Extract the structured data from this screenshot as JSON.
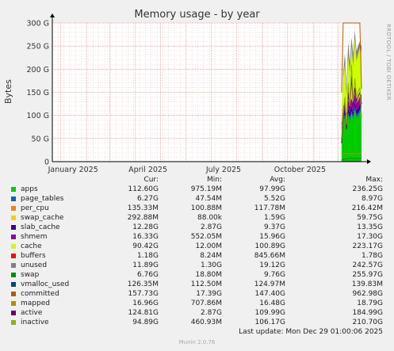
{
  "title": "Memory usage - by year",
  "watermark": "RRDTOOL / TOBI OETIKER",
  "chart_data": {
    "type": "area",
    "title": "Memory usage - by year",
    "ylabel": "Bytes",
    "ylim": [
      0,
      300
    ],
    "y_unit": "G",
    "yticks": [
      "0",
      "50 G",
      "100 G",
      "150 G",
      "200 G",
      "250 G",
      "300 G"
    ],
    "xticks": [
      "January 2025",
      "April 2025",
      "July 2025",
      "October 2025"
    ],
    "grid": true,
    "data_window": [
      "2024-12-22",
      "2025-12-29"
    ],
    "x": [
      "2025-12-05",
      "2025-12-07",
      "2025-12-09",
      "2025-12-11",
      "2025-12-13",
      "2025-12-15",
      "2025-12-17",
      "2025-12-19",
      "2025-12-21",
      "2025-12-23",
      "2025-12-25",
      "2025-12-27",
      "2025-12-29"
    ],
    "series": [
      {
        "name": "apps",
        "color": "#00cc00",
        "values": [
          60,
          92,
          95,
          75,
          100,
          88,
          103,
          90,
          112,
          95,
          98,
          105,
          112
        ]
      },
      {
        "name": "page_tables",
        "color": "#0066b3",
        "values": [
          3,
          4,
          5,
          4,
          5,
          6,
          5,
          6,
          6,
          5,
          6,
          6,
          6
        ]
      },
      {
        "name": "per_cpu",
        "color": "#ff8000",
        "values": [
          0.1,
          0.1,
          0.1,
          0.1,
          0.1,
          0.1,
          0.1,
          0.1,
          0.1,
          0.1,
          0.1,
          0.1,
          0.1
        ]
      },
      {
        "name": "swap_cache",
        "color": "#ffcc00",
        "values": [
          0.3,
          0.3,
          0.3,
          0.3,
          0.3,
          0.3,
          0.3,
          0.3,
          0.3,
          0.3,
          0.3,
          0.3,
          0.3
        ]
      },
      {
        "name": "slab_cache",
        "color": "#330099",
        "values": [
          8,
          10,
          12,
          9,
          11,
          12,
          13,
          10,
          12,
          11,
          12,
          13,
          12
        ]
      },
      {
        "name": "shmem",
        "color": "#990099",
        "values": [
          12,
          14,
          16,
          15,
          16,
          17,
          16,
          15,
          17,
          16,
          16,
          17,
          16
        ]
      },
      {
        "name": "cache",
        "color": "#ccff00",
        "values": [
          25,
          60,
          80,
          40,
          95,
          70,
          110,
          85,
          120,
          90,
          100,
          105,
          90
        ]
      },
      {
        "name": "buffers",
        "color": "#ff0000",
        "values": [
          0.5,
          0.8,
          1,
          0.8,
          1,
          1.2,
          1.1,
          1,
          1.3,
          1.1,
          1.2,
          1.2,
          1.2
        ]
      },
      {
        "name": "unused",
        "color": "#808080",
        "values": [
          2,
          10,
          25,
          15,
          30,
          20,
          20,
          25,
          15,
          20,
          18,
          12,
          12
        ]
      }
    ],
    "lines": [
      {
        "name": "swap",
        "color": "#008f00",
        "values": [
          3,
          5,
          6,
          6,
          7,
          6,
          7,
          6,
          7,
          7,
          6,
          7,
          7
        ]
      },
      {
        "name": "vmalloc_used",
        "color": "#00487d",
        "values": [
          0.12,
          0.12,
          0.13,
          0.12,
          0.13,
          0.12,
          0.13,
          0.12,
          0.13,
          0.13,
          0.13,
          0.13,
          0.13
        ]
      },
      {
        "name": "committed",
        "color": "#b35a00",
        "values": [
          150,
          600,
          900,
          400,
          962,
          300,
          700,
          500,
          800,
          400,
          600,
          500,
          158
        ]
      },
      {
        "name": "mapped",
        "color": "#b38f00",
        "values": [
          14,
          16,
          18,
          17,
          18,
          17,
          18,
          17,
          18,
          17,
          17,
          18,
          17
        ]
      },
      {
        "name": "active",
        "color": "#6b006b",
        "values": [
          40,
          90,
          130,
          70,
          150,
          110,
          185,
          120,
          160,
          130,
          140,
          150,
          125
        ]
      },
      {
        "name": "inactive",
        "color": "#8fb300",
        "values": [
          50,
          100,
          140,
          80,
          170,
          120,
          210,
          130,
          180,
          140,
          150,
          160,
          95
        ]
      }
    ]
  },
  "legend": {
    "headers": [
      "Cur:",
      "Min:",
      "Avg:",
      "Max:"
    ],
    "rows": [
      {
        "name": "apps",
        "color": "#00cc00",
        "cur": "112.60G",
        "min": "975.19M",
        "avg": "97.99G",
        "max": "236.25G"
      },
      {
        "name": "page_tables",
        "color": "#0066b3",
        "cur": "6.27G",
        "min": "47.54M",
        "avg": "5.52G",
        "max": "8.97G"
      },
      {
        "name": "per_cpu",
        "color": "#ff8000",
        "cur": "135.33M",
        "min": "100.88M",
        "avg": "117.78M",
        "max": "216.42M"
      },
      {
        "name": "swap_cache",
        "color": "#ffcc00",
        "cur": "292.88M",
        "min": "88.00k",
        "avg": "1.59G",
        "max": "59.75G"
      },
      {
        "name": "slab_cache",
        "color": "#330099",
        "cur": "12.28G",
        "min": "2.87G",
        "avg": "9.37G",
        "max": "13.35G"
      },
      {
        "name": "shmem",
        "color": "#990099",
        "cur": "16.33G",
        "min": "552.05M",
        "avg": "15.96G",
        "max": "17.30G"
      },
      {
        "name": "cache",
        "color": "#ccff00",
        "cur": "90.42G",
        "min": "12.00M",
        "avg": "100.89G",
        "max": "223.17G"
      },
      {
        "name": "buffers",
        "color": "#ff0000",
        "cur": "1.18G",
        "min": "8.24M",
        "avg": "845.66M",
        "max": "1.78G"
      },
      {
        "name": "unused",
        "color": "#808080",
        "cur": "11.89G",
        "min": "1.30G",
        "avg": "19.12G",
        "max": "242.57G"
      },
      {
        "name": "swap",
        "color": "#008f00",
        "cur": "6.76G",
        "min": "18.80M",
        "avg": "9.76G",
        "max": "255.97G"
      },
      {
        "name": "vmalloc_used",
        "color": "#00487d",
        "cur": "126.35M",
        "min": "112.50M",
        "avg": "124.97M",
        "max": "139.83M"
      },
      {
        "name": "committed",
        "color": "#b35a00",
        "cur": "157.73G",
        "min": "17.39G",
        "avg": "147.40G",
        "max": "962.98G"
      },
      {
        "name": "mapped",
        "color": "#b38f00",
        "cur": "16.96G",
        "min": "707.86M",
        "avg": "16.48G",
        "max": "18.79G"
      },
      {
        "name": "active",
        "color": "#6b006b",
        "cur": "124.81G",
        "min": "2.87G",
        "avg": "109.99G",
        "max": "184.99G"
      },
      {
        "name": "inactive",
        "color": "#8fb300",
        "cur": "94.89G",
        "min": "460.93M",
        "avg": "106.17G",
        "max": "210.70G"
      }
    ]
  },
  "last_update": "Last update: Mon Dec 29 01:00:06 2025",
  "version": "Munin 2.0.76"
}
